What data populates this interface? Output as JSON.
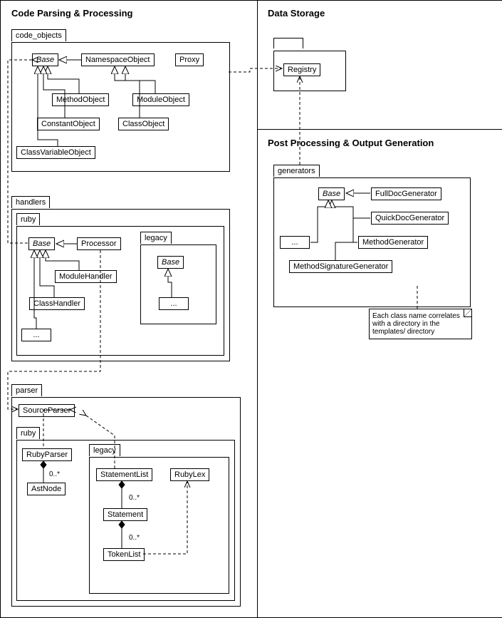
{
  "sections": {
    "parsing": "Code Parsing & Processing",
    "storage": "Data Storage",
    "post": "Post Processing & Output Generation"
  },
  "packages": {
    "code_objects": "code_objects",
    "handlers": "handlers",
    "ruby1": "ruby",
    "legacy1": "legacy",
    "parser": "parser",
    "ruby2": "ruby",
    "legacy2": "legacy",
    "generators": "generators"
  },
  "classes": {
    "co_base": "Base",
    "co_namespace": "NamespaceObject",
    "co_proxy": "Proxy",
    "co_method": "MethodObject",
    "co_module": "ModuleObject",
    "co_constant": "ConstantObject",
    "co_class": "ClassObject",
    "co_classvar": "ClassVariableObject",
    "h_base": "Base",
    "h_processor": "Processor",
    "h_module": "ModuleHandler",
    "h_class": "ClassHandler",
    "h_ellipsis": "...",
    "h_lbase": "Base",
    "h_lellipsis": "...",
    "p_source": "SourceParser",
    "p_ruby": "RubyParser",
    "p_ast": "AstNode",
    "p_stmtlist": "StatementList",
    "p_stmt": "Statement",
    "p_tokenlist": "TokenList",
    "p_rubylex": "RubyLex",
    "registry": "Registry",
    "g_base": "Base",
    "g_fulldoc": "FullDocGenerator",
    "g_quickdoc": "QuickDocGenerator",
    "g_method": "MethodGenerator",
    "g_methsig": "MethodSignatureGenerator",
    "g_ellipsis": "..."
  },
  "labels": {
    "mult1": "0..*",
    "mult2": "0..*",
    "mult3": "0..*"
  },
  "note": "Each class name correlates with a directory in the templates/ directory"
}
